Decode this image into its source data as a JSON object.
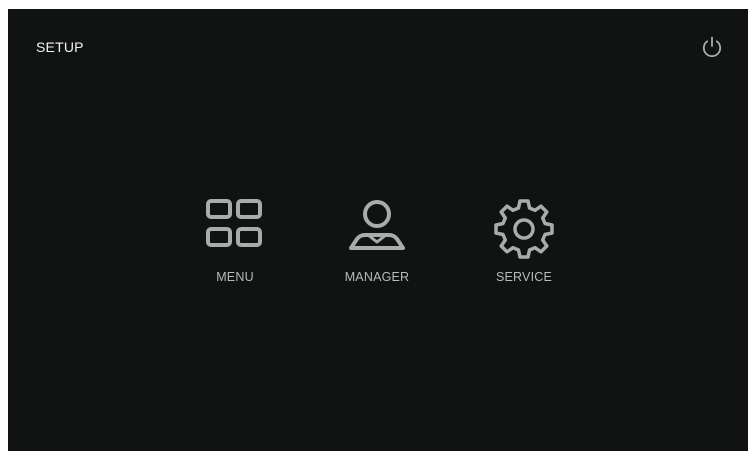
{
  "header": {
    "title": "SETUP",
    "power_icon": "power-icon"
  },
  "tiles": [
    {
      "label": "MENU",
      "icon": "grid-icon"
    },
    {
      "label": "MANAGER",
      "icon": "user-icon"
    },
    {
      "label": "SERVICE",
      "icon": "gear-icon"
    }
  ],
  "colors": {
    "background": "#111313",
    "title_text": "#f2f2f2",
    "icon_stroke": "#a9abad",
    "label_text": "#b8babb"
  }
}
